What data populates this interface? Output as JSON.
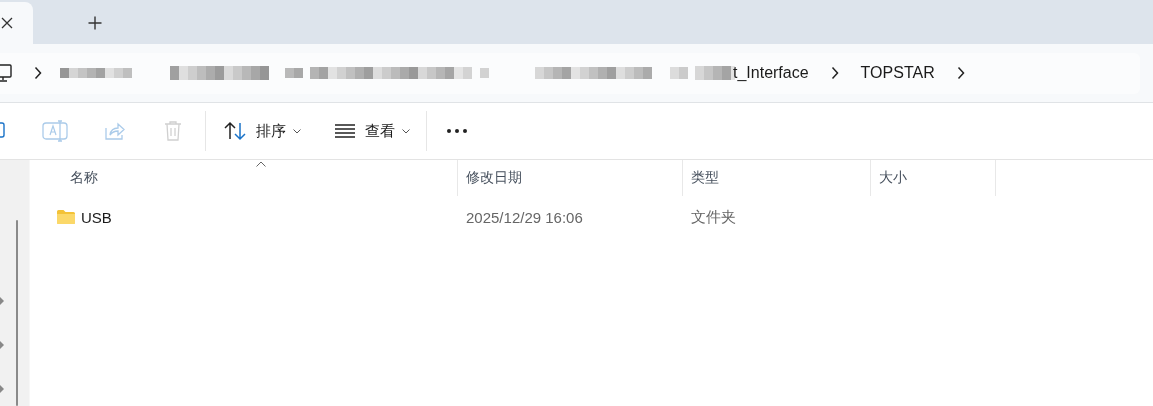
{
  "tabs": [
    {
      "kind": "close",
      "selected": true
    },
    {
      "kind": "new",
      "selected": false
    }
  ],
  "breadcrumb": [
    {
      "kind": "device"
    },
    {
      "kind": "redacted"
    },
    {
      "kind": "text",
      "label": "t_Interface"
    },
    {
      "kind": "text",
      "label": "TOPSTAR"
    }
  ],
  "toolbar": [
    {
      "kind": "new",
      "disabled": false
    },
    {
      "kind": "rename",
      "disabled": true
    },
    {
      "kind": "share",
      "disabled": true
    },
    {
      "kind": "delete",
      "disabled": true
    },
    {
      "kind": "separator"
    },
    {
      "kind": "sort",
      "label": "排序"
    },
    {
      "kind": "view",
      "label": "查看"
    },
    {
      "kind": "separator"
    },
    {
      "kind": "more"
    }
  ],
  "table": {
    "columns": [
      {
        "label": "名称",
        "sorted": true
      },
      {
        "label": "修改日期",
        "sorted": false
      },
      {
        "label": "类型",
        "sorted": false
      },
      {
        "label": "大小",
        "sorted": false
      }
    ],
    "rows": [
      {
        "kind": "folder",
        "cells": [
          "USB",
          "2025/12/29 16:06",
          "文件夹"
        ]
      }
    ]
  }
}
